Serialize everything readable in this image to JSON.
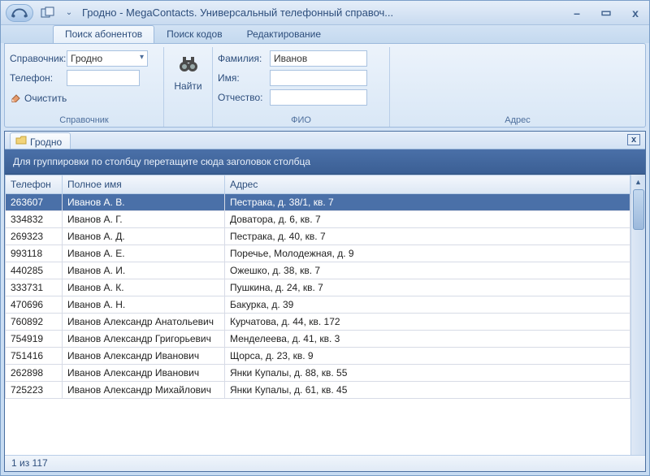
{
  "window": {
    "title": "Гродно - MegaContacts. Универсальный телефонный справоч...",
    "ribbon_toggle": "⌄"
  },
  "tabs": {
    "search_abon": "Поиск абонентов",
    "search_codes": "Поиск кодов",
    "editing": "Редактирование"
  },
  "ribbon": {
    "spravochnik": {
      "label": "Справочник:",
      "value": "Гродно",
      "tel_label": "Телефон:",
      "tel_value": "",
      "clear": "Очистить",
      "group": "Справочник"
    },
    "find_btn": "Найти",
    "fio": {
      "fam_label": "Фамилия:",
      "fam_value": "Иванов",
      "name_label": "Имя:",
      "name_value": "",
      "patr_label": "Отчество:",
      "patr_value": "",
      "group": "ФИО"
    },
    "addr": {
      "group": "Адрес"
    }
  },
  "doc_tab": "Гродно",
  "group_hint": "Для группировки по столбцу перетащите сюда заголовок столбца",
  "columns": {
    "phone": "Телефон",
    "name": "Полное имя",
    "addr": "Адрес"
  },
  "rows": [
    {
      "phone": "263607",
      "name": "Иванов А. В.",
      "addr": "Пестрака, д. 38/1, кв. 7"
    },
    {
      "phone": "334832",
      "name": "Иванов А. Г.",
      "addr": "Доватора, д. 6, кв. 7"
    },
    {
      "phone": "269323",
      "name": "Иванов А. Д.",
      "addr": "Пестрака, д. 40, кв. 7"
    },
    {
      "phone": "993118",
      "name": "Иванов А. Е.",
      "addr": "Поречье, Молодежная, д. 9"
    },
    {
      "phone": "440285",
      "name": "Иванов А. И.",
      "addr": "Ожешко, д. 38, кв. 7"
    },
    {
      "phone": "333731",
      "name": "Иванов А. К.",
      "addr": "Пушкина, д. 24, кв. 7"
    },
    {
      "phone": "470696",
      "name": "Иванов А. Н.",
      "addr": "Бакурка, д. 39"
    },
    {
      "phone": "760892",
      "name": "Иванов Александр Анатольевич",
      "addr": "Курчатова, д. 44, кв. 172"
    },
    {
      "phone": "754919",
      "name": "Иванов Александр Григорьевич",
      "addr": "Менделеева, д. 41, кв. 3"
    },
    {
      "phone": "751416",
      "name": "Иванов Александр Иванович",
      "addr": "Щорса, д. 23, кв. 9"
    },
    {
      "phone": "262898",
      "name": "Иванов Александр Иванович",
      "addr": "Янки Купалы, д. 88, кв. 55"
    },
    {
      "phone": "725223",
      "name": "Иванов Александр Михайлович",
      "addr": "Янки Купалы, д. 61, кв. 45"
    }
  ],
  "status": "1 из 117"
}
